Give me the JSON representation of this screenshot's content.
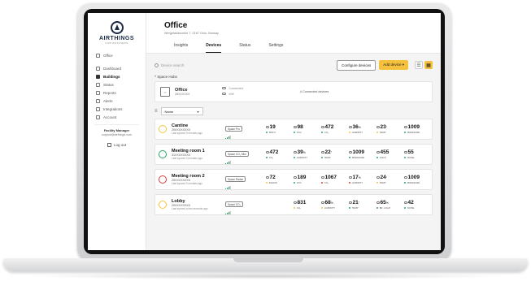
{
  "colors": {
    "green": "#2aa564",
    "yellow": "#f6c23e",
    "red": "#d9393c"
  },
  "brand": {
    "name": "AIRTHINGS",
    "subtitle": "FOR BUSINESS"
  },
  "sidebar": {
    "items": [
      {
        "label": "Office",
        "icon": "location-icon"
      },
      {
        "label": "Dashboard",
        "icon": "dashboard-icon"
      },
      {
        "label": "Buildings",
        "icon": "building-icon",
        "active": true
      },
      {
        "label": "Status",
        "icon": "status-icon"
      },
      {
        "label": "Reports",
        "icon": "report-icon"
      },
      {
        "label": "Alerts",
        "icon": "bell-icon"
      },
      {
        "label": "Integrations",
        "icon": "integrations-icon"
      },
      {
        "label": "Account",
        "icon": "account-icon"
      }
    ],
    "user_title": "Facility Manager",
    "user_email": "support@airthings.com",
    "logout_label": "Log out"
  },
  "header": {
    "title": "Office",
    "address": "Wergelandsveien 7, 0167 Oslo, Norway",
    "tabs": [
      "Insights",
      "Devices",
      "Status",
      "Settings"
    ],
    "active_tab": "Devices"
  },
  "toolbar": {
    "search_placeholder": "Device search",
    "configure_label": "Configure devices",
    "add_label": "Add device"
  },
  "hubs": {
    "section_label": "Space Hubs",
    "items": [
      {
        "name": "Office",
        "serial": "28XXXXXX",
        "status_cloud": "Connected",
        "status_wifi": "Wifi",
        "connected": "4 Connected devices"
      }
    ]
  },
  "sort": {
    "label": "Name"
  },
  "devices": [
    {
      "name": "Cantine",
      "serial": "29XXXXXXXX",
      "sync": "Last synced 9 minutes ago",
      "model": "Space Pro",
      "status": "yellow",
      "signal": 3,
      "sensors": [
        {
          "value": "19",
          "unit": "",
          "name": "PM2.5",
          "dot": "green"
        },
        {
          "value": "98",
          "unit": "",
          "name": "VOC",
          "dot": "green"
        },
        {
          "value": "472",
          "unit": "",
          "name": "CO₂",
          "dot": "green"
        },
        {
          "value": "36",
          "unit": "%",
          "name": "HUMIDITY",
          "dot": "yellow"
        },
        {
          "value": "23",
          "unit": "°",
          "name": "TEMP",
          "dot": "yellow"
        },
        {
          "value": "1009",
          "unit": "",
          "name": "PRESSURE",
          "dot": "green"
        }
      ]
    },
    {
      "name": "Meeting room 1",
      "serial": "31XXXXXXXX",
      "sync": "Last synced 3 minutes ago",
      "model": "Space CO₂ Mini",
      "status": "green",
      "signal": 3,
      "sensors": [
        {
          "value": "472",
          "unit": "",
          "name": "CO₂",
          "dot": "green"
        },
        {
          "value": "39",
          "unit": "%",
          "name": "HUMIDITY",
          "dot": "green"
        },
        {
          "value": "22",
          "unit": "°",
          "name": "TEMP",
          "dot": "green"
        },
        {
          "value": "1009",
          "unit": "",
          "name": "PRESSURE",
          "dot": "green"
        },
        {
          "value": "455",
          "unit": "",
          "name": "LIGHT",
          "dot": "green"
        },
        {
          "value": "55",
          "unit": "",
          "name": "NOISE",
          "dot": "green"
        }
      ]
    },
    {
      "name": "Meeting room 2",
      "serial": "29XXXXXXXX",
      "sync": "Last synced 5 minutes ago",
      "model": "Space Radon",
      "status": "red",
      "signal": 3,
      "sensors": [
        {
          "value": "72",
          "unit": "",
          "name": "RADON",
          "dot": "yellow"
        },
        {
          "value": "189",
          "unit": "",
          "name": "VOC",
          "dot": "green"
        },
        {
          "value": "1067",
          "unit": "",
          "name": "CO₂",
          "dot": "red"
        },
        {
          "value": "17",
          "unit": "%",
          "name": "HUMIDITY",
          "dot": "red"
        },
        {
          "value": "24",
          "unit": "°",
          "name": "TEMP",
          "dot": "yellow"
        },
        {
          "value": "1009",
          "unit": "",
          "name": "PRESSURE",
          "dot": "green"
        }
      ]
    },
    {
      "name": "Lobby",
      "serial": "29XXXXXXXX",
      "sync": "Last synced a few seconds ago",
      "model": "Space CO₂",
      "status": "yellow",
      "signal": 3,
      "sensors": [
        {
          "value": "",
          "unit": "",
          "name": "",
          "dot": ""
        },
        {
          "value": "831",
          "unit": "",
          "name": "CO₂",
          "dot": "yellow"
        },
        {
          "value": "68",
          "unit": "%",
          "name": "HUMIDITY",
          "dot": "yellow"
        },
        {
          "value": "21",
          "unit": "°",
          "name": "TEMP",
          "dot": "green"
        },
        {
          "value": "65",
          "unit": "%",
          "name": "BR. LIGHT",
          "dot": "green"
        },
        {
          "value": "42",
          "unit": "",
          "name": "NOISE",
          "dot": "green"
        }
      ]
    }
  ]
}
